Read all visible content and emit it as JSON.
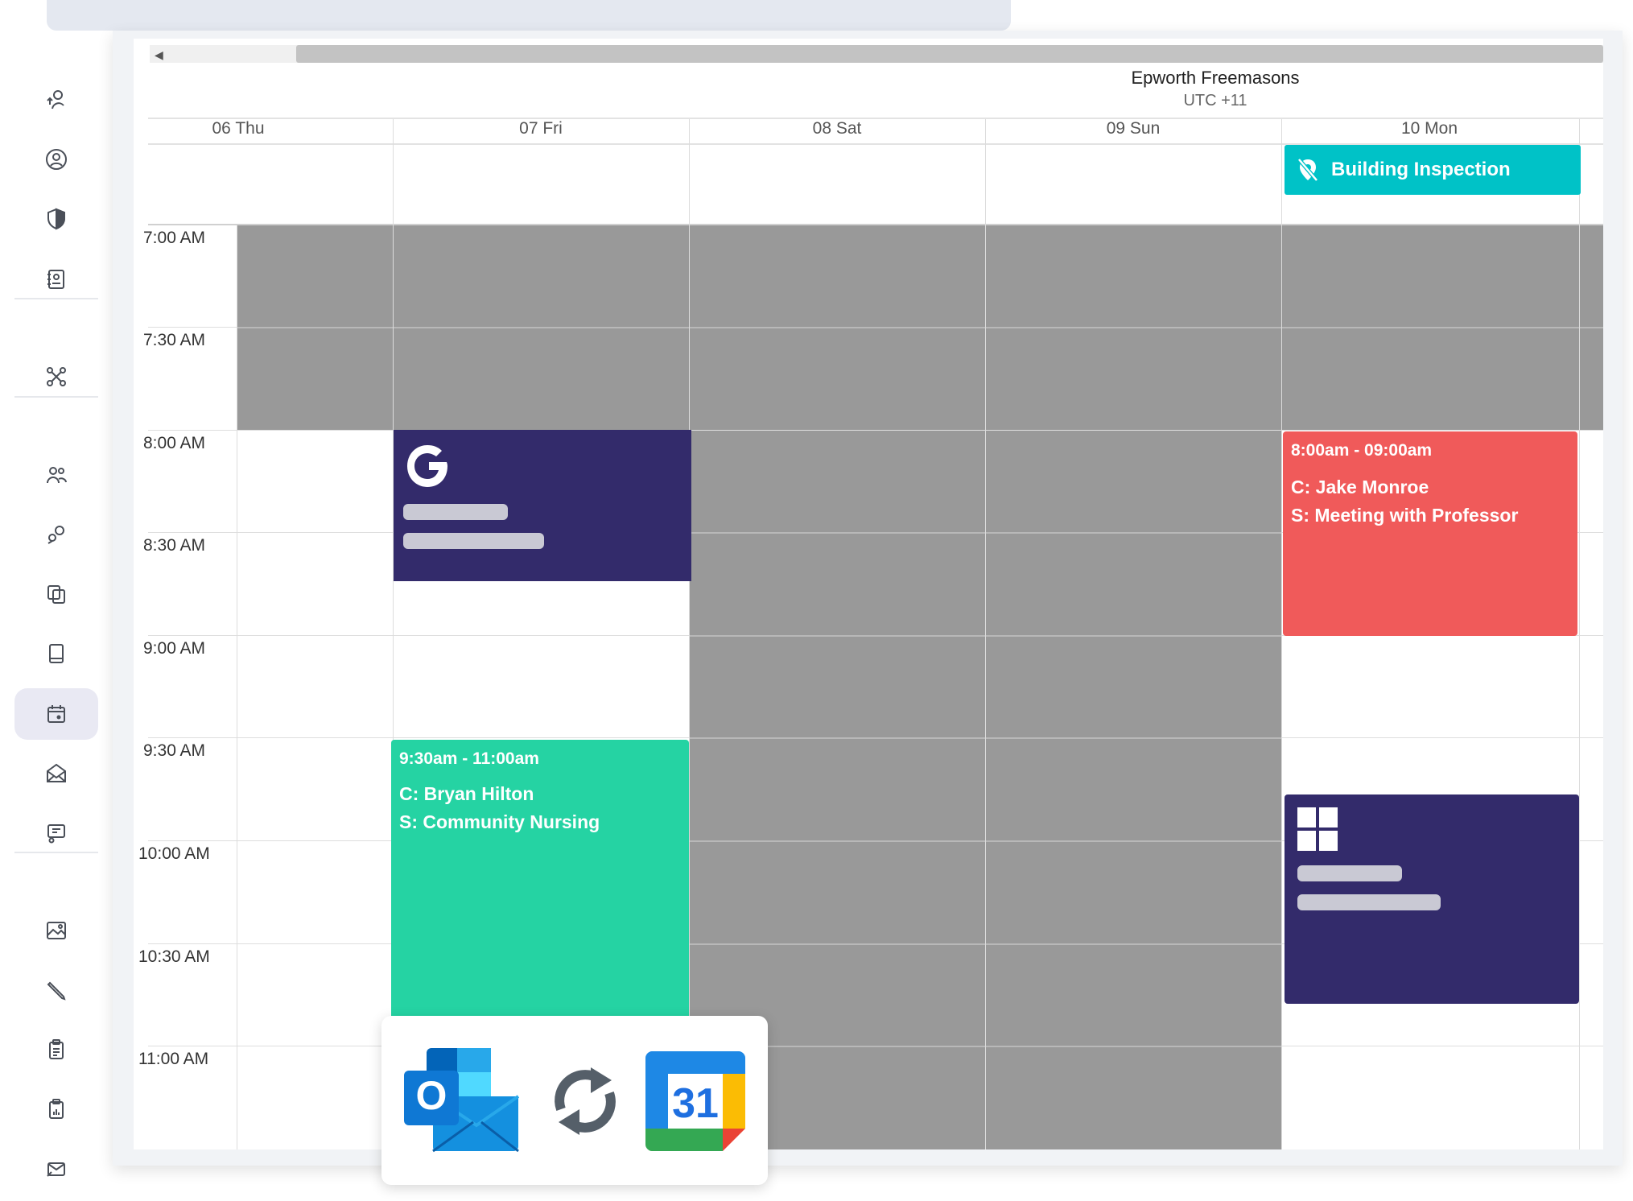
{
  "calendar": {
    "resource_name": "Epworth Freemasons",
    "timezone": "UTC +11",
    "days": [
      "06 Thu",
      "07 Fri",
      "08 Sat",
      "09 Sun",
      "10 Mon"
    ],
    "times": [
      "7:00 AM",
      "7:30 AM",
      "8:00 AM",
      "8:30 AM",
      "9:00 AM",
      "9:30 AM",
      "10:00 AM",
      "10:30 AM",
      "11:00 AM"
    ]
  },
  "events": {
    "all_day": {
      "label": "Building Inspection",
      "color": "#00c2c7"
    },
    "jake": {
      "time": "8:00am - 09:00am",
      "client": "C: Jake Monroe",
      "subject": "S: Meeting with Professor",
      "color": "#f05a5a"
    },
    "bryan": {
      "time": "9:30am - 11:00am",
      "client": "C: Bryan Hilton",
      "subject": "S: Community Nursing",
      "color": "#25d3a3"
    },
    "google": {
      "icon": "google-g-icon",
      "color": "#332b6b"
    },
    "microsoft": {
      "icon": "windows-icon",
      "color": "#332b6b"
    }
  },
  "sync_card": {
    "outlook_letter": "O",
    "gcal_number": "31"
  },
  "sidebar": {
    "icons": [
      "user-switch-icon",
      "user-circle-icon",
      "shield-icon",
      "contacts-icon",
      "network-icon",
      "team-icon",
      "location-pins-icon",
      "copy-icon",
      "book-icon",
      "calendar-icon",
      "mail-open-icon",
      "chat-settings-icon",
      "image-icon",
      "pencil-icon",
      "clipboard-icon",
      "report-icon",
      "mail-send-icon"
    ],
    "active": "calendar-icon"
  }
}
